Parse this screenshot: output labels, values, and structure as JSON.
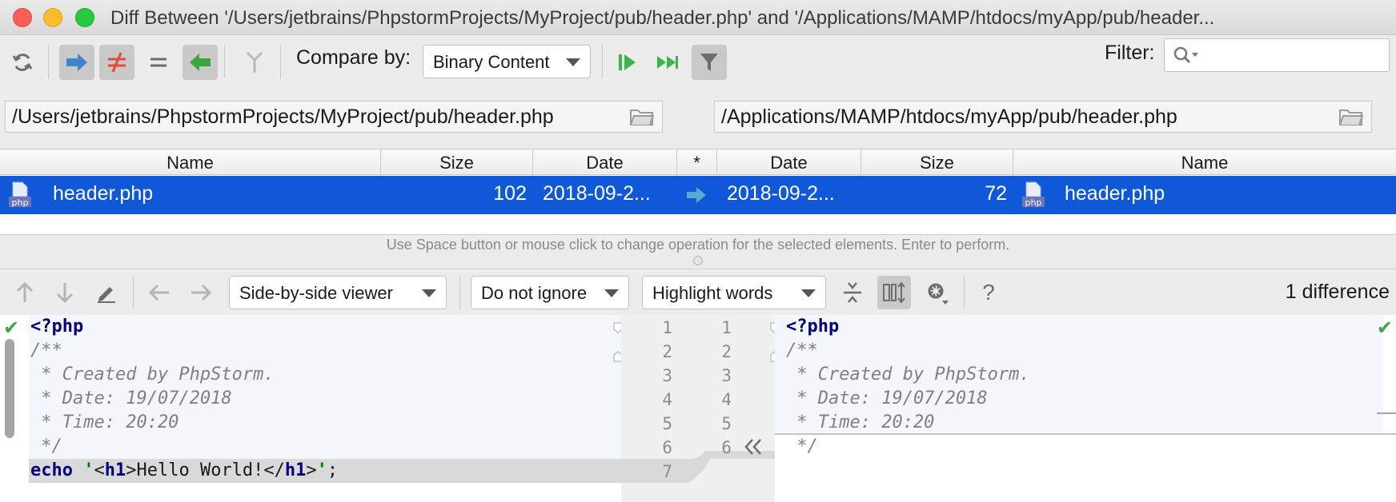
{
  "window": {
    "title": "Diff Between '/Users/jetbrains/PhpstormProjects/MyProject/pub/header.php' and '/Applications/MAMP/htdocs/myApp/pub/header..."
  },
  "toolbar": {
    "compare_label": "Compare by:",
    "compare_value": "Binary Content",
    "filter_label": "Filter:",
    "filter_value": ""
  },
  "paths": {
    "left": "/Users/jetbrains/PhpstormProjects/MyProject/pub/header.php",
    "right": "/Applications/MAMP/htdocs/myApp/pub/header.php"
  },
  "table": {
    "columns": [
      "Name",
      "Size",
      "Date",
      "*",
      "Date",
      "Size",
      "Name"
    ],
    "row": {
      "left_name": "header.php",
      "left_size": "102",
      "left_date": "2018-09-2...",
      "right_date": "2018-09-2...",
      "right_size": "72",
      "right_name": "header.php",
      "icon_text": "php"
    }
  },
  "hint": "Use Space button or mouse click to change operation for the selected elements. Enter to perform.",
  "diff_toolbar": {
    "viewer": "Side-by-side viewer",
    "ignore": "Do not ignore",
    "highlight": "Highlight words",
    "count": "1 difference",
    "help": "?"
  },
  "left_code": {
    "l1": "<?php",
    "l2": "/**",
    "l3": " * Created by PhpStorm.",
    "l4": " * Date: 19/07/2018",
    "l5": " * Time: 20:20",
    "l6": " */",
    "l7_kw": "echo",
    "l7_q1": " '",
    "l7_t1": "<",
    "l7_h1a": "h1",
    "l7_t2": ">Hello World!</",
    "l7_h1b": "h1",
    "l7_t3": ">",
    "l7_q2": "'",
    "l7_end": ";"
  },
  "right_code": {
    "l1": "<?php",
    "l2": "/**",
    "l3": " * Created by PhpStorm.",
    "l4": " * Date: 19/07/2018",
    "l5": " * Time: 20:20",
    "l6": " */"
  },
  "line_numbers": {
    "left": [
      "1",
      "2",
      "3",
      "4",
      "5",
      "6",
      "7"
    ],
    "right": [
      "1",
      "2",
      "3",
      "4",
      "5",
      "6"
    ]
  },
  "colors": {
    "selection": "#0f58d8",
    "added_bg": "#f3f7fc",
    "changed_bg": "#d9d9d9",
    "accent_blue": "#3d87c9",
    "accent_green": "#3da63a"
  }
}
